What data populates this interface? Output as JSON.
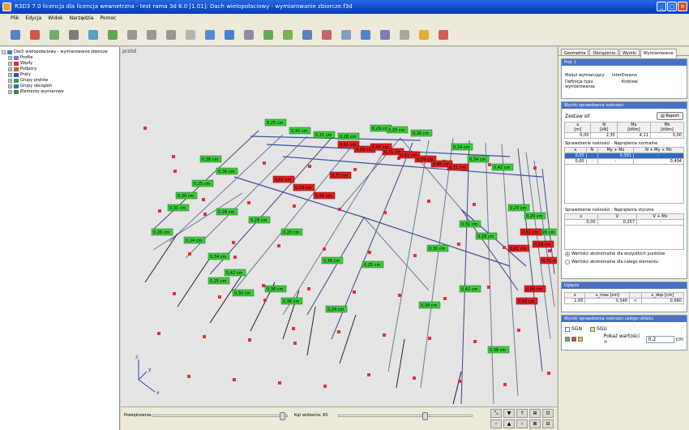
{
  "window": {
    "title": "R3D3 7.0 licencja dla licencja wewnetrzna - test rama 3d 6.0 [1.01]: Dach wielopołaciowy - wymiarowanie zbiorcze.f3d",
    "min": "_",
    "max": "□",
    "close": "×"
  },
  "menu": [
    "Plik",
    "Edycja",
    "Widok",
    "Narzędzia",
    "Pomoc"
  ],
  "toolbar_colors": [
    "#3a6fcf",
    "#d23a2a",
    "#58a35a",
    "#6a6a6a",
    "#3a8fc0",
    "#4b9a3a",
    "#888",
    "#888",
    "#888",
    "#aaa",
    "#3a7bd0",
    "#2a6fcf",
    "#7a7aa0",
    "#4c9f3c",
    "#6aa63a",
    "#4070c0",
    "#c05050",
    "#7090c0",
    "#3a70d0",
    "#6a6ab0",
    "#9a9a9a",
    "#e0a020",
    "#cc4444"
  ],
  "tree": {
    "root": "Dach wielopołaciowy - wymiarowanie zbiorcze",
    "items": [
      {
        "label": "Profile",
        "color": "#8a6fcf"
      },
      {
        "label": "Węzły",
        "color": "#d03030"
      },
      {
        "label": "Podpory",
        "color": "#d06020"
      },
      {
        "label": "Pręty",
        "color": "#3050c0"
      },
      {
        "label": "Grupy prętów",
        "color": "#40a040"
      },
      {
        "label": "Grupy obciążeń",
        "color": "#3070c0"
      },
      {
        "label": "Elementy wymiarowe",
        "color": "#508050"
      }
    ]
  },
  "viewport": {
    "label": "przód",
    "axis_x": "x",
    "axis_y": "y",
    "axis_z": "z"
  },
  "model_labels": {
    "green": [
      "0,25 cm",
      "0,30 cm",
      "0,31 cm",
      "0,28 cm",
      "0,29 cm",
      "0,20 cm",
      "0,26 cm",
      "0,24 cm",
      "0,34 cm",
      "0,42 cm",
      "0,38 cm",
      "0,36 cm"
    ],
    "red": [
      "0,61 cm",
      "0,59 cm",
      "0,66 cm",
      "0,71 cm"
    ]
  },
  "bottombar": {
    "zoom_label": "Powiększenie",
    "angle_label": "Kąt widzenia: 60"
  },
  "nav_buttons": [
    "⤡",
    "▼",
    "↑",
    "⊞",
    "⊡",
    "›",
    "▲",
    "‹",
    "⊠",
    "⊟"
  ],
  "tabs": [
    "Geometria",
    "Obciążenia",
    "Wyniki",
    "Wymiarowanie"
  ],
  "rod": {
    "header": "Pręt 1",
    "module_label": "Moduł wymiarujący:",
    "module_value": "InterDrewno",
    "def_label": "Definicja typu wymiarowania:",
    "def_value": "Krokiew"
  },
  "capacity": {
    "header": "Wyniki sprawdzenia nośności",
    "forces_label": "Zestaw sił",
    "report_button": "Raport",
    "forces_cols": [
      "x\n[m]",
      "N\n[kN]",
      "My\n[kNm]",
      "Mz\n[kNm]"
    ],
    "forces_row": [
      "0,00",
      "2,35",
      "4,11",
      "0,00"
    ],
    "normal_title": "Sprawdzenie nośności - Naprężenia normalne",
    "normal_cols": [
      "x",
      "N",
      "My + Mz",
      "N + My + Mz"
    ],
    "normal_rows": [
      [
        "0,00",
        "-",
        "0,391",
        "-"
      ],
      [
        "0,00",
        "-",
        "-",
        "0,404"
      ]
    ],
    "shear_title": "Sprawdzenie nośności - Naprężenia styczne",
    "shear_cols": [
      "x",
      "V",
      "V + Mx"
    ],
    "shear_rows": [
      [
        "0,00",
        "0,257",
        "-"
      ]
    ],
    "radio1": "Wartości ekstremalne dla wszystkich punktów",
    "radio2": "Wartości ekstremalne dla całego elementu"
  },
  "deflection": {
    "header": "Ugięcie",
    "cols": [
      "x",
      "u_max [cm]",
      "",
      "u_dop [cm]"
    ],
    "row": [
      "1,65",
      "0,548",
      "<",
      "0,660"
    ]
  },
  "system": {
    "header": "Wyniki sprawdzenia nośności całego układu",
    "sgn": "SGN",
    "sgu": "SGU",
    "show_label": "Pokaż wartości >",
    "show_value": "0,2",
    "unit": "cm"
  }
}
